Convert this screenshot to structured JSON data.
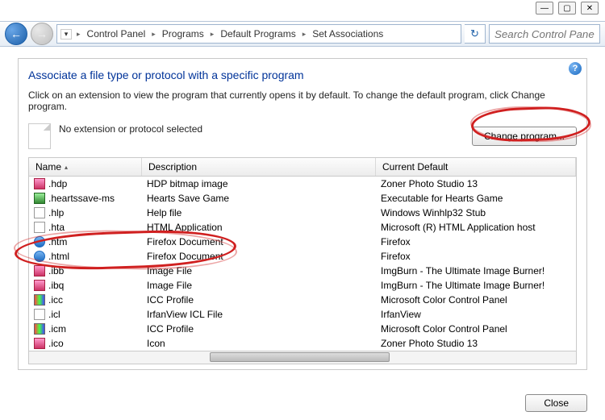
{
  "window_controls": {
    "min": "—",
    "max": "▢",
    "close": "✕"
  },
  "nav": {
    "back_title": "Back",
    "fwd_title": "Forward",
    "refresh_title": "Refresh"
  },
  "breadcrumb": {
    "dropdown_glyph": "▾",
    "items": [
      "Control Panel",
      "Programs",
      "Default Programs",
      "Set Associations"
    ],
    "chevron": "▸"
  },
  "search": {
    "placeholder": "Search Control Panel"
  },
  "help_glyph": "?",
  "title": "Associate a file type or protocol with a specific program",
  "instruction": "Click on an extension to view the program that currently opens it by default. To change the default program, click Change program.",
  "no_extension_text": "No extension or protocol selected",
  "change_button": "Change program...",
  "columns": {
    "name": "Name",
    "desc": "Description",
    "def": "Current Default"
  },
  "sort_indicator": "▴",
  "rows": [
    {
      "icon": "img",
      "ext": ".hdp",
      "desc": "HDP bitmap image",
      "def": "Zoner Photo Studio 13"
    },
    {
      "icon": "green",
      "ext": ".heartssave-ms",
      "desc": "Hearts Save Game",
      "def": "Executable for Hearts Game"
    },
    {
      "icon": "plain",
      "ext": ".hlp",
      "desc": "Help file",
      "def": "Windows Winhlp32 Stub"
    },
    {
      "icon": "plain",
      "ext": ".hta",
      "desc": "HTML Application",
      "def": "Microsoft (R) HTML Application host"
    },
    {
      "icon": "blue",
      "ext": ".htm",
      "desc": "Firefox Document",
      "def": "Firefox"
    },
    {
      "icon": "blue",
      "ext": ".html",
      "desc": "Firefox Document",
      "def": "Firefox"
    },
    {
      "icon": "img",
      "ext": ".ibb",
      "desc": "Image File",
      "def": "ImgBurn - The Ultimate Image Burner!"
    },
    {
      "icon": "img",
      "ext": ".ibq",
      "desc": "Image File",
      "def": "ImgBurn - The Ultimate Image Burner!"
    },
    {
      "icon": "rainbow",
      "ext": ".icc",
      "desc": "ICC Profile",
      "def": "Microsoft Color Control Panel"
    },
    {
      "icon": "plain",
      "ext": ".icl",
      "desc": "IrfanView ICL File",
      "def": "IrfanView"
    },
    {
      "icon": "rainbow",
      "ext": ".icm",
      "desc": "ICC Profile",
      "def": "Microsoft Color Control Panel"
    },
    {
      "icon": "img",
      "ext": ".ico",
      "desc": "Icon",
      "def": "Zoner Photo Studio 13"
    }
  ],
  "close_label": "Close"
}
